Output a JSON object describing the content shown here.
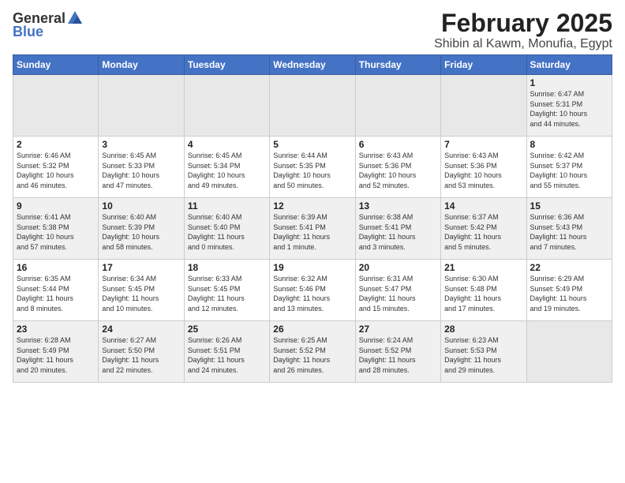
{
  "header": {
    "logo_general": "General",
    "logo_blue": "Blue",
    "month_title": "February 2025",
    "location": "Shibin al Kawm, Monufia, Egypt"
  },
  "days_of_week": [
    "Sunday",
    "Monday",
    "Tuesday",
    "Wednesday",
    "Thursday",
    "Friday",
    "Saturday"
  ],
  "weeks": [
    [
      {
        "day": "",
        "info": ""
      },
      {
        "day": "",
        "info": ""
      },
      {
        "day": "",
        "info": ""
      },
      {
        "day": "",
        "info": ""
      },
      {
        "day": "",
        "info": ""
      },
      {
        "day": "",
        "info": ""
      },
      {
        "day": "1",
        "info": "Sunrise: 6:47 AM\nSunset: 5:31 PM\nDaylight: 10 hours\nand 44 minutes."
      }
    ],
    [
      {
        "day": "2",
        "info": "Sunrise: 6:46 AM\nSunset: 5:32 PM\nDaylight: 10 hours\nand 46 minutes."
      },
      {
        "day": "3",
        "info": "Sunrise: 6:45 AM\nSunset: 5:33 PM\nDaylight: 10 hours\nand 47 minutes."
      },
      {
        "day": "4",
        "info": "Sunrise: 6:45 AM\nSunset: 5:34 PM\nDaylight: 10 hours\nand 49 minutes."
      },
      {
        "day": "5",
        "info": "Sunrise: 6:44 AM\nSunset: 5:35 PM\nDaylight: 10 hours\nand 50 minutes."
      },
      {
        "day": "6",
        "info": "Sunrise: 6:43 AM\nSunset: 5:36 PM\nDaylight: 10 hours\nand 52 minutes."
      },
      {
        "day": "7",
        "info": "Sunrise: 6:43 AM\nSunset: 5:36 PM\nDaylight: 10 hours\nand 53 minutes."
      },
      {
        "day": "8",
        "info": "Sunrise: 6:42 AM\nSunset: 5:37 PM\nDaylight: 10 hours\nand 55 minutes."
      }
    ],
    [
      {
        "day": "9",
        "info": "Sunrise: 6:41 AM\nSunset: 5:38 PM\nDaylight: 10 hours\nand 57 minutes."
      },
      {
        "day": "10",
        "info": "Sunrise: 6:40 AM\nSunset: 5:39 PM\nDaylight: 10 hours\nand 58 minutes."
      },
      {
        "day": "11",
        "info": "Sunrise: 6:40 AM\nSunset: 5:40 PM\nDaylight: 11 hours\nand 0 minutes."
      },
      {
        "day": "12",
        "info": "Sunrise: 6:39 AM\nSunset: 5:41 PM\nDaylight: 11 hours\nand 1 minute."
      },
      {
        "day": "13",
        "info": "Sunrise: 6:38 AM\nSunset: 5:41 PM\nDaylight: 11 hours\nand 3 minutes."
      },
      {
        "day": "14",
        "info": "Sunrise: 6:37 AM\nSunset: 5:42 PM\nDaylight: 11 hours\nand 5 minutes."
      },
      {
        "day": "15",
        "info": "Sunrise: 6:36 AM\nSunset: 5:43 PM\nDaylight: 11 hours\nand 7 minutes."
      }
    ],
    [
      {
        "day": "16",
        "info": "Sunrise: 6:35 AM\nSunset: 5:44 PM\nDaylight: 11 hours\nand 8 minutes."
      },
      {
        "day": "17",
        "info": "Sunrise: 6:34 AM\nSunset: 5:45 PM\nDaylight: 11 hours\nand 10 minutes."
      },
      {
        "day": "18",
        "info": "Sunrise: 6:33 AM\nSunset: 5:45 PM\nDaylight: 11 hours\nand 12 minutes."
      },
      {
        "day": "19",
        "info": "Sunrise: 6:32 AM\nSunset: 5:46 PM\nDaylight: 11 hours\nand 13 minutes."
      },
      {
        "day": "20",
        "info": "Sunrise: 6:31 AM\nSunset: 5:47 PM\nDaylight: 11 hours\nand 15 minutes."
      },
      {
        "day": "21",
        "info": "Sunrise: 6:30 AM\nSunset: 5:48 PM\nDaylight: 11 hours\nand 17 minutes."
      },
      {
        "day": "22",
        "info": "Sunrise: 6:29 AM\nSunset: 5:49 PM\nDaylight: 11 hours\nand 19 minutes."
      }
    ],
    [
      {
        "day": "23",
        "info": "Sunrise: 6:28 AM\nSunset: 5:49 PM\nDaylight: 11 hours\nand 20 minutes."
      },
      {
        "day": "24",
        "info": "Sunrise: 6:27 AM\nSunset: 5:50 PM\nDaylight: 11 hours\nand 22 minutes."
      },
      {
        "day": "25",
        "info": "Sunrise: 6:26 AM\nSunset: 5:51 PM\nDaylight: 11 hours\nand 24 minutes."
      },
      {
        "day": "26",
        "info": "Sunrise: 6:25 AM\nSunset: 5:52 PM\nDaylight: 11 hours\nand 26 minutes."
      },
      {
        "day": "27",
        "info": "Sunrise: 6:24 AM\nSunset: 5:52 PM\nDaylight: 11 hours\nand 28 minutes."
      },
      {
        "day": "28",
        "info": "Sunrise: 6:23 AM\nSunset: 5:53 PM\nDaylight: 11 hours\nand 29 minutes."
      },
      {
        "day": "",
        "info": ""
      }
    ]
  ]
}
